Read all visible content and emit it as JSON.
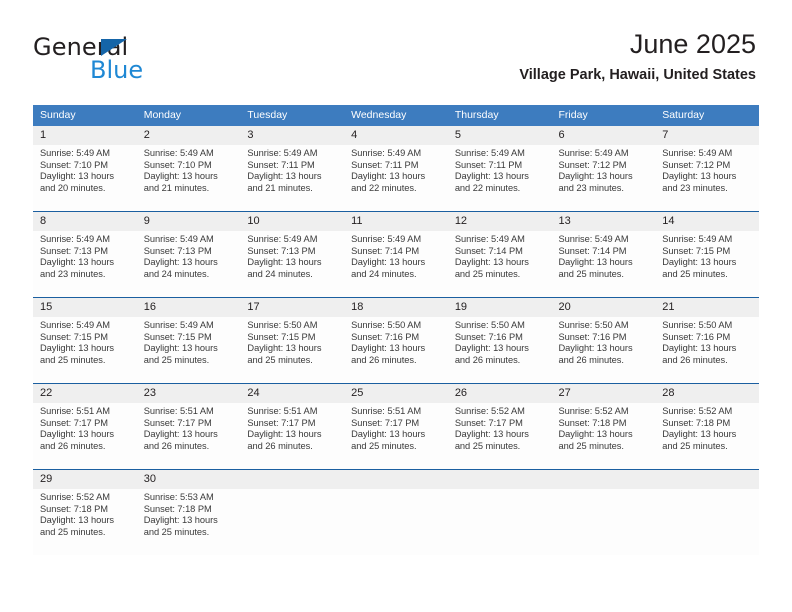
{
  "brand": {
    "name_part1": "General",
    "name_part2": "Blue",
    "triangle_color": "#1565a8",
    "blue_text_color": "#1f88d4"
  },
  "header": {
    "title": "June 2025",
    "subtitle": "Village Park, Hawaii, United States"
  },
  "theme": {
    "header_blue": "#3d7cbf",
    "separator_blue": "#1b5fa0",
    "daynum_band": "#efefef",
    "cell_background": "#fdfdfd",
    "text_color": "#231f20"
  },
  "weekday_headers": [
    "Sunday",
    "Monday",
    "Tuesday",
    "Wednesday",
    "Thursday",
    "Friday",
    "Saturday"
  ],
  "weeks": [
    {
      "days": [
        {
          "day": "1",
          "sunrise": "Sunrise: 5:49 AM",
          "sunset": "Sunset: 7:10 PM",
          "daylight_line1": "Daylight: 13 hours",
          "daylight_line2": "and 20 minutes."
        },
        {
          "day": "2",
          "sunrise": "Sunrise: 5:49 AM",
          "sunset": "Sunset: 7:10 PM",
          "daylight_line1": "Daylight: 13 hours",
          "daylight_line2": "and 21 minutes."
        },
        {
          "day": "3",
          "sunrise": "Sunrise: 5:49 AM",
          "sunset": "Sunset: 7:11 PM",
          "daylight_line1": "Daylight: 13 hours",
          "daylight_line2": "and 21 minutes."
        },
        {
          "day": "4",
          "sunrise": "Sunrise: 5:49 AM",
          "sunset": "Sunset: 7:11 PM",
          "daylight_line1": "Daylight: 13 hours",
          "daylight_line2": "and 22 minutes."
        },
        {
          "day": "5",
          "sunrise": "Sunrise: 5:49 AM",
          "sunset": "Sunset: 7:11 PM",
          "daylight_line1": "Daylight: 13 hours",
          "daylight_line2": "and 22 minutes."
        },
        {
          "day": "6",
          "sunrise": "Sunrise: 5:49 AM",
          "sunset": "Sunset: 7:12 PM",
          "daylight_line1": "Daylight: 13 hours",
          "daylight_line2": "and 23 minutes."
        },
        {
          "day": "7",
          "sunrise": "Sunrise: 5:49 AM",
          "sunset": "Sunset: 7:12 PM",
          "daylight_line1": "Daylight: 13 hours",
          "daylight_line2": "and 23 minutes."
        }
      ]
    },
    {
      "days": [
        {
          "day": "8",
          "sunrise": "Sunrise: 5:49 AM",
          "sunset": "Sunset: 7:13 PM",
          "daylight_line1": "Daylight: 13 hours",
          "daylight_line2": "and 23 minutes."
        },
        {
          "day": "9",
          "sunrise": "Sunrise: 5:49 AM",
          "sunset": "Sunset: 7:13 PM",
          "daylight_line1": "Daylight: 13 hours",
          "daylight_line2": "and 24 minutes."
        },
        {
          "day": "10",
          "sunrise": "Sunrise: 5:49 AM",
          "sunset": "Sunset: 7:13 PM",
          "daylight_line1": "Daylight: 13 hours",
          "daylight_line2": "and 24 minutes."
        },
        {
          "day": "11",
          "sunrise": "Sunrise: 5:49 AM",
          "sunset": "Sunset: 7:14 PM",
          "daylight_line1": "Daylight: 13 hours",
          "daylight_line2": "and 24 minutes."
        },
        {
          "day": "12",
          "sunrise": "Sunrise: 5:49 AM",
          "sunset": "Sunset: 7:14 PM",
          "daylight_line1": "Daylight: 13 hours",
          "daylight_line2": "and 25 minutes."
        },
        {
          "day": "13",
          "sunrise": "Sunrise: 5:49 AM",
          "sunset": "Sunset: 7:14 PM",
          "daylight_line1": "Daylight: 13 hours",
          "daylight_line2": "and 25 minutes."
        },
        {
          "day": "14",
          "sunrise": "Sunrise: 5:49 AM",
          "sunset": "Sunset: 7:15 PM",
          "daylight_line1": "Daylight: 13 hours",
          "daylight_line2": "and 25 minutes."
        }
      ]
    },
    {
      "days": [
        {
          "day": "15",
          "sunrise": "Sunrise: 5:49 AM",
          "sunset": "Sunset: 7:15 PM",
          "daylight_line1": "Daylight: 13 hours",
          "daylight_line2": "and 25 minutes."
        },
        {
          "day": "16",
          "sunrise": "Sunrise: 5:49 AM",
          "sunset": "Sunset: 7:15 PM",
          "daylight_line1": "Daylight: 13 hours",
          "daylight_line2": "and 25 minutes."
        },
        {
          "day": "17",
          "sunrise": "Sunrise: 5:50 AM",
          "sunset": "Sunset: 7:15 PM",
          "daylight_line1": "Daylight: 13 hours",
          "daylight_line2": "and 25 minutes."
        },
        {
          "day": "18",
          "sunrise": "Sunrise: 5:50 AM",
          "sunset": "Sunset: 7:16 PM",
          "daylight_line1": "Daylight: 13 hours",
          "daylight_line2": "and 26 minutes."
        },
        {
          "day": "19",
          "sunrise": "Sunrise: 5:50 AM",
          "sunset": "Sunset: 7:16 PM",
          "daylight_line1": "Daylight: 13 hours",
          "daylight_line2": "and 26 minutes."
        },
        {
          "day": "20",
          "sunrise": "Sunrise: 5:50 AM",
          "sunset": "Sunset: 7:16 PM",
          "daylight_line1": "Daylight: 13 hours",
          "daylight_line2": "and 26 minutes."
        },
        {
          "day": "21",
          "sunrise": "Sunrise: 5:50 AM",
          "sunset": "Sunset: 7:16 PM",
          "daylight_line1": "Daylight: 13 hours",
          "daylight_line2": "and 26 minutes."
        }
      ]
    },
    {
      "days": [
        {
          "day": "22",
          "sunrise": "Sunrise: 5:51 AM",
          "sunset": "Sunset: 7:17 PM",
          "daylight_line1": "Daylight: 13 hours",
          "daylight_line2": "and 26 minutes."
        },
        {
          "day": "23",
          "sunrise": "Sunrise: 5:51 AM",
          "sunset": "Sunset: 7:17 PM",
          "daylight_line1": "Daylight: 13 hours",
          "daylight_line2": "and 26 minutes."
        },
        {
          "day": "24",
          "sunrise": "Sunrise: 5:51 AM",
          "sunset": "Sunset: 7:17 PM",
          "daylight_line1": "Daylight: 13 hours",
          "daylight_line2": "and 26 minutes."
        },
        {
          "day": "25",
          "sunrise": "Sunrise: 5:51 AM",
          "sunset": "Sunset: 7:17 PM",
          "daylight_line1": "Daylight: 13 hours",
          "daylight_line2": "and 25 minutes."
        },
        {
          "day": "26",
          "sunrise": "Sunrise: 5:52 AM",
          "sunset": "Sunset: 7:17 PM",
          "daylight_line1": "Daylight: 13 hours",
          "daylight_line2": "and 25 minutes."
        },
        {
          "day": "27",
          "sunrise": "Sunrise: 5:52 AM",
          "sunset": "Sunset: 7:18 PM",
          "daylight_line1": "Daylight: 13 hours",
          "daylight_line2": "and 25 minutes."
        },
        {
          "day": "28",
          "sunrise": "Sunrise: 5:52 AM",
          "sunset": "Sunset: 7:18 PM",
          "daylight_line1": "Daylight: 13 hours",
          "daylight_line2": "and 25 minutes."
        }
      ]
    },
    {
      "days": [
        {
          "day": "29",
          "sunrise": "Sunrise: 5:52 AM",
          "sunset": "Sunset: 7:18 PM",
          "daylight_line1": "Daylight: 13 hours",
          "daylight_line2": "and 25 minutes."
        },
        {
          "day": "30",
          "sunrise": "Sunrise: 5:53 AM",
          "sunset": "Sunset: 7:18 PM",
          "daylight_line1": "Daylight: 13 hours",
          "daylight_line2": "and 25 minutes."
        },
        {
          "day": "",
          "sunrise": "",
          "sunset": "",
          "daylight_line1": "",
          "daylight_line2": ""
        },
        {
          "day": "",
          "sunrise": "",
          "sunset": "",
          "daylight_line1": "",
          "daylight_line2": ""
        },
        {
          "day": "",
          "sunrise": "",
          "sunset": "",
          "daylight_line1": "",
          "daylight_line2": ""
        },
        {
          "day": "",
          "sunrise": "",
          "sunset": "",
          "daylight_line1": "",
          "daylight_line2": ""
        },
        {
          "day": "",
          "sunrise": "",
          "sunset": "",
          "daylight_line1": "",
          "daylight_line2": ""
        }
      ]
    }
  ]
}
